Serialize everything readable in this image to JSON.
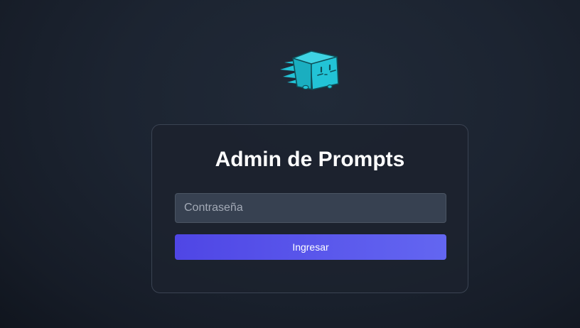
{
  "logo": {
    "icon": "flying-cube-mascot-icon",
    "color": "#22c3d6"
  },
  "login": {
    "title": "Admin de Prompts",
    "password_placeholder": "Contraseña",
    "password_value": "",
    "submit_label": "Ingresar"
  },
  "colors": {
    "accent": "#4f46e5",
    "accent_end": "#6366f1",
    "logo": "#22c3d6",
    "background": "#1c2431"
  }
}
